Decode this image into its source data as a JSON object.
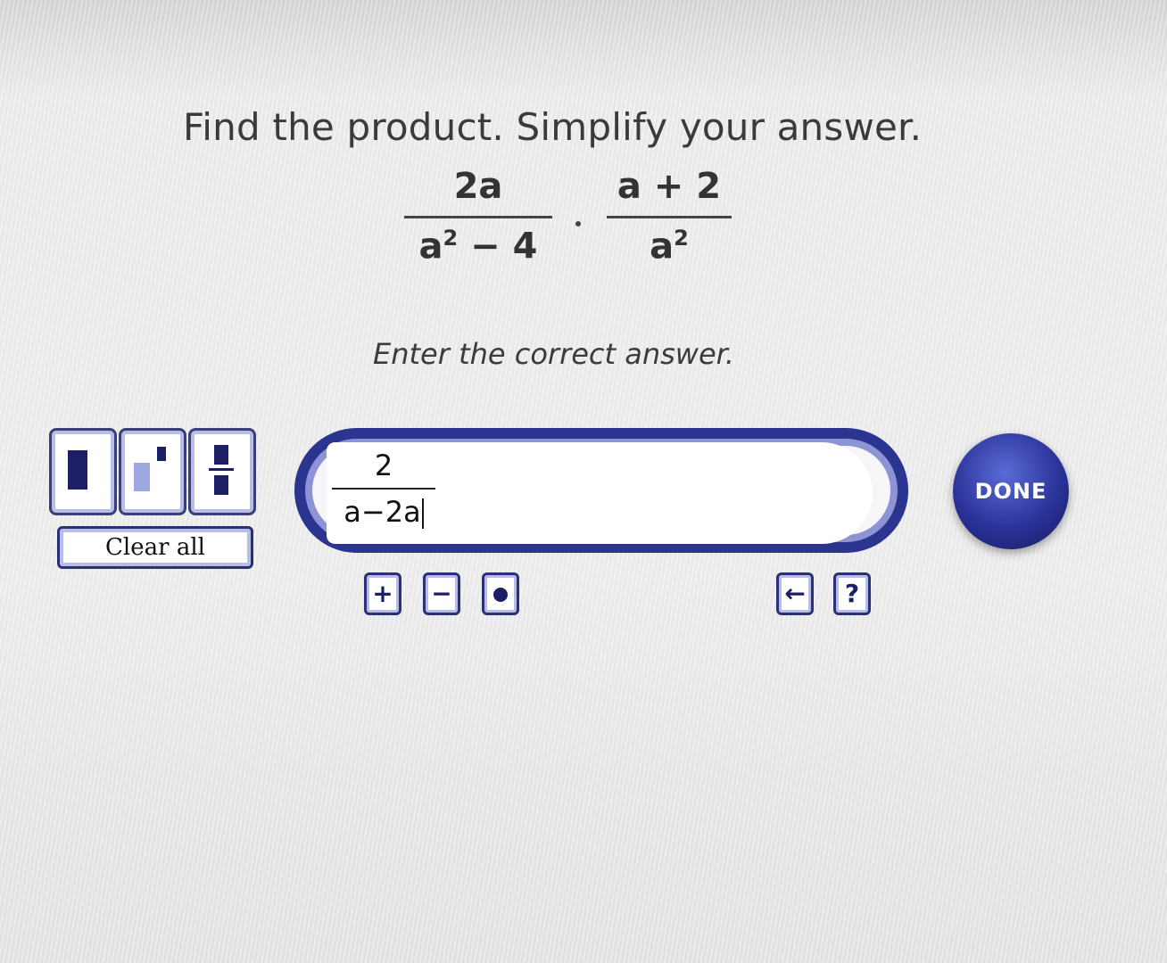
{
  "question": {
    "prompt": "Find the product. Simplify your answer.",
    "fraction1": {
      "numerator": "2a",
      "denominator_base": "a",
      "denominator_exp": "2",
      "denominator_rest": " − 4"
    },
    "operator": "·",
    "fraction2": {
      "numerator": "a + 2",
      "denominator_base": "a",
      "denominator_exp": "2"
    }
  },
  "instruction": "Enter the correct answer.",
  "answer": {
    "numerator": "2",
    "denominator": "a−2a"
  },
  "toolbar": {
    "clear_all": "Clear all",
    "plus": "+",
    "minus": "−",
    "help": "?"
  },
  "done_label": "DONE",
  "colors": {
    "accent": "#2b3590",
    "accent_light": "#b7bde6"
  },
  "icons": [
    "fraction-template-icon",
    "exponent-template-icon",
    "mixed-number-template-icon",
    "backspace-icon",
    "help-icon"
  ]
}
